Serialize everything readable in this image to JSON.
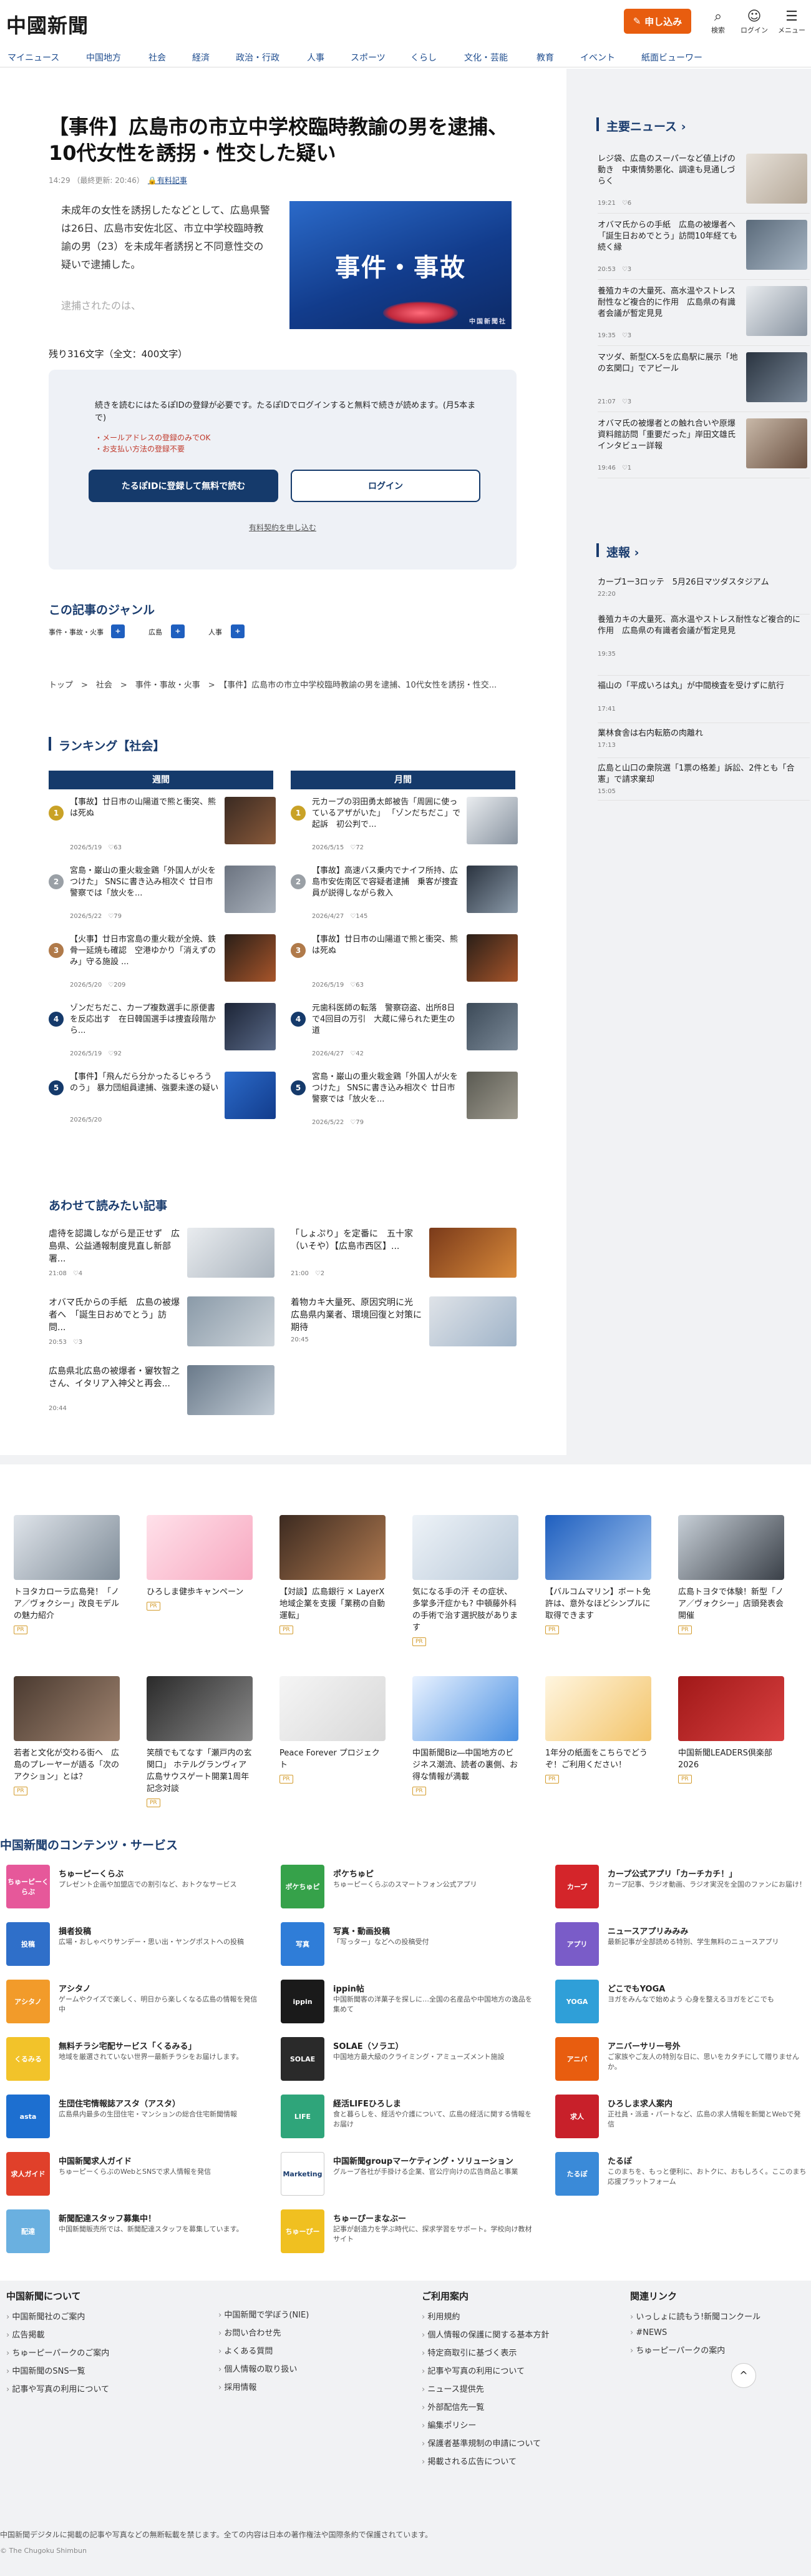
{
  "header": {
    "logo": "中國新聞",
    "apply": "申し込み",
    "icons": [
      {
        "icon": "search-icon",
        "label": "検索"
      },
      {
        "icon": "login-icon",
        "label": "ログイン"
      },
      {
        "icon": "menu-icon",
        "label": "メニュー"
      }
    ]
  },
  "nav": [
    "マイニュース",
    "中国地方",
    "社会",
    "経済",
    "政治・行政",
    "人事",
    "スポーツ",
    "くらし",
    "文化・芸能",
    "教育",
    "イベント",
    "紙面ビューワー"
  ],
  "article": {
    "title": "【事件】広島市の市立中学校臨時教諭の男を逮捕、10代女性を誘拐・性交した疑い",
    "time": "14:29",
    "updated": "（最終更新: 20:46）",
    "badge": "有料記事",
    "lead": "未成年の女性を誘拐したなどとして、広島県警は26日、広島市安佐北区、市立中学校臨時教諭の男（23）を未成年者誘拐と不同意性交の疑いで逮捕した。",
    "fade": "逮捕されたのは、",
    "image_text": "事件・事故",
    "image_caption": "中国新聞社",
    "remaining": "残り316文字（全文：400文字）"
  },
  "paywall": {
    "text": "続きを読むにはたるぽIDの登録が必要です。たるぽIDでログインすると無料で続きが読めます。(月5本まで)",
    "note1": "・メールアドレスの登録のみでOK",
    "note2": "・お支払い方法の登録不要",
    "register": "たるぽIDに登録して無料で読む",
    "login": "ログイン",
    "paid": "有料契約を申し込む"
  },
  "genre": {
    "title": "この記事のジャンル",
    "tags": [
      "事件・事故・火事",
      "広島",
      "人事"
    ]
  },
  "breadcrumb": "トップ　>　社会　>　事件・事故・火事　>　【事件】広島市の市立中学校臨時教諭の男を逮捕、10代女性を誘拐・性交...",
  "ranking": {
    "title": "ランキング【社会】",
    "weekly_label": "週間",
    "monthly_label": "月間",
    "weekly": [
      {
        "n": "1",
        "t": "【事故】廿日市の山陽道で熊と衝突、熊は死ぬ",
        "d": "2026/5/19　♡63"
      },
      {
        "n": "2",
        "t": "宮島・巌山の重火栽金鶏「外国人が火をつけた」 SNSに書き込み相次ぐ 廿日市警察では「放火を...",
        "d": "2026/5/22　♡79"
      },
      {
        "n": "3",
        "t": "【火事】廿日市宮島の重火栽が全焼、鉄骨一延焼も確認　空港ゆかり「消えずのみ」守る施設 ...",
        "d": "2026/5/20　♡209"
      },
      {
        "n": "4",
        "t": "ゾンだちだこ、カープ複数選手に原便書を反応出す　在日韓国選手は捜査段階から...",
        "d": "2026/5/19　♡92"
      },
      {
        "n": "5",
        "t": "【事件】「飛んだら分かったるじゃろうのう」 暴力団組員逮捕、強要未遂の疑い",
        "d": "2026/5/20"
      }
    ],
    "monthly": [
      {
        "n": "1",
        "t": "元カープの羽田勇太郎被告「周囲に使っているアザがいた」 「ゾンだちだこ」で起訴　初公判で...",
        "d": "2026/5/15　♡72"
      },
      {
        "n": "2",
        "t": "【事故】高速バス乗内でナイフ所持、広島市安佐南区で容疑者逮捕　乗客が捜査員が説得しながら救入",
        "d": "2026/4/27　♡145"
      },
      {
        "n": "3",
        "t": "【事故】廿日市の山陽道で熊と衝突、熊は死ぬ",
        "d": "2026/5/19　♡63"
      },
      {
        "n": "4",
        "t": "元歯科医師の転落　警察窃盗、出所8日で4回目の万引　大蔵に帰られた更生の道",
        "d": "2026/4/27　♡42"
      },
      {
        "n": "5",
        "t": "宮島・巌山の重火栽金鶏「外国人が火をつけた」 SNSに書き込み相次ぐ 廿日市警察では「放火を...",
        "d": "2026/5/22　♡79"
      }
    ]
  },
  "recommend": {
    "title": "あわせて読みたい記事",
    "items": [
      {
        "t": "虐待を認識しながら是正せず　広島県、公益通報制度見直し新部署...",
        "d": "21:08　♡4"
      },
      {
        "t": "「しょぷり」を定番に　五十家（いそや）【広島市西区】...",
        "d": "21:00　♡2"
      },
      {
        "t": "オバマ氏からの手紙　広島の被爆者へ　「誕生日おめでとう」訪問...",
        "d": "20:53　♡3"
      },
      {
        "t": "着物カキ大量死、原因究明に光　広島県内業者、環境回復と対策に期待",
        "d": "20:45"
      },
      {
        "t": "広島県北広島の被爆者・窶牧智之さん、イタリア入神父と再会...",
        "d": "20:44"
      }
    ]
  },
  "sidebar": {
    "main_title": "主要ニュース",
    "main_items": [
      {
        "t": "レジ袋、広島のスーパーなど値上げの動き　中東情勢悪化、調達も見通しづらく",
        "d": "19:21　♡6"
      },
      {
        "t": "オバマ氏からの手紙　広島の被爆者へ「誕生日おめでとう」訪問10年経ても続く縁",
        "d": "20:53　♡3"
      },
      {
        "t": "養殖カキの大量死、高水温やストレス耐性など複合的に作用　広島県の有識者会議が暫定見見",
        "d": "19:35　♡3"
      },
      {
        "t": "マツダ、新型CX-5を広島駅に展示「地の玄関口」でアピール",
        "d": "21:07　♡3"
      },
      {
        "t": "オバマ氏の被爆者との触れ合いや原爆資料館訪問「重要だった」岸田文雄氏インタビュー詳報",
        "d": "19:46　♡1"
      }
    ],
    "flash_title": "速報",
    "flash_items": [
      {
        "t": "カープ1ー3ロッテ　5月26日マツダスタジアム",
        "d": "22:20"
      },
      {
        "t": "養殖カキの大量死、高水温やストレス耐性など複合的に作用　広島県の有識者会議が暫定見見",
        "d": "19:35"
      },
      {
        "t": "福山の「平成いろは丸」が中間検査を受けずに航行",
        "d": "17:41"
      },
      {
        "t": "業林食舎は右内転筋の肉離れ",
        "d": "17:13"
      },
      {
        "t": "広島と山口の衆院選「1票の格差」訴訟、2件とも「合憲」で請求棄却",
        "d": "15:05"
      }
    ]
  },
  "promos": [
    {
      "t": "トヨタカローラ広島発！「ノア／ヴォクシー」改良モデルの魅力紹介"
    },
    {
      "t": "ひろしま健歩キャンペーン"
    },
    {
      "t": "【対談】広島銀行 × LayerX 地域企業を支援「業務の自動運転」"
    },
    {
      "t": "気になる手の汗 その症状、多掌多汗症かも? 中頓藤外科の手術で治す選択肢があります"
    },
    {
      "t": "【バルコムマリン】ボート免許は、意外なほどシンプルに取得できます"
    },
    {
      "t": "広島トヨタで体験！新型「ノア／ヴォクシー」店頭発表会開催"
    },
    {
      "t": "若者と文化が交わる街へ　広島のプレーヤーが語る「次のアクション」とは？"
    },
    {
      "t": "笑顔でもてなす「瀬戸内の玄関口」 ホテルグランヴィア広島サウスゲート開業1周年記念対談"
    },
    {
      "t": "Peace Forever プロジェクト"
    },
    {
      "t": "中国新聞Biz―中国地方のビジネス潮流、読者の裏側、お得な情報が満載"
    },
    {
      "t": "1年分の紙面をこちらでどうぞ！ご利用ください！"
    },
    {
      "t": "中国新聞LEADERS倶楽部2026"
    }
  ],
  "promo_pr": "PR",
  "services": {
    "title": "中国新聞のコンテンツ・サービス",
    "items": [
      {
        "icon": "ちゅーピーくらぶ",
        "name": "ちゅーピーくらぶ",
        "desc": "プレゼント企画や加盟店での割引など、おトクなサービス"
      },
      {
        "icon": "ポケちゅピ",
        "name": "ポケちゅピ",
        "desc": "ちゅーピーくらぶのスマートフォン公式アプリ"
      },
      {
        "icon": "カープ",
        "name": "カープ公式アプリ「カーチカチ！」",
        "desc": "カープ記事、ラジオ動画、ラジオ実況を全国のファンにお届け！"
      },
      {
        "icon": "投稿",
        "name": "損者投稿",
        "desc": "広場・おしゃべりサンデー・思い出・ヤングポストへの投稿"
      },
      {
        "icon": "写真",
        "name": "写真・動画投稿",
        "desc": "「写っター」などへの投稿受付"
      },
      {
        "icon": "アプリ",
        "name": "ニュースアプリみみみ",
        "desc": "最新記事が全部読める特別、学生無料のニュースアプリ"
      },
      {
        "icon": "アシタノ",
        "name": "アシタノ",
        "desc": "ゲームやクイズで楽しく、明日から楽しくなる広島の情報を発信中"
      },
      {
        "icon": "ippin",
        "name": "ippin帖",
        "desc": "中国新聞客の洋菓子を探しに…全国の名産品や中国地方の逸品を集めて"
      },
      {
        "icon": "YOGA",
        "name": "どこでもYOGA",
        "desc": "ヨガをみんなで始めよう 心身を整えるヨガをどこでも"
      },
      {
        "icon": "くるみる",
        "name": "無料チラシ宅配サービス「くるみる」",
        "desc": "地域を厳選されていない世界一最新チラシをお届けします。"
      },
      {
        "icon": "SOLAE",
        "name": "SOLAE（ソラエ）",
        "desc": "中国地方最大級のクライミング・アミューズメント施設"
      },
      {
        "icon": "アニバ",
        "name": "アニバーサリー号外",
        "desc": "ご家族やご友人の特別な日に、思いをカタチにして贈りませんか。"
      },
      {
        "icon": "asta",
        "name": "生団住宅情報誌アスタ（アスタ）",
        "desc": "広島県内最多の生団住宅・マンションの総合住宅新聞情報"
      },
      {
        "icon": "LIFE",
        "name": "経活LIFEひろしま",
        "desc": "食と暮らしを、経活や介護について、広島の経活に関する情報をお届け"
      },
      {
        "icon": "求人",
        "name": "ひろしま求人案内",
        "desc": "正社員・派遣・パートなど、広島の求人情報を新聞とWebで発信"
      },
      {
        "icon": "求人ガイド",
        "name": "中国新聞求人ガイド",
        "desc": "ちゅーピーくらぶのWebとSNSで求人情報を発信"
      },
      {
        "icon": "Marketing",
        "name": "中国新聞groupマーケティング・ソリューション",
        "desc": "グループ各社が手掛ける企業、官公庁向けの広告商品と事業"
      },
      {
        "icon": "たるぽ",
        "name": "たるぽ",
        "desc": "このまちを、もっと便利に、おトクに、おもしろく。ここのまち応援プラットフォーム"
      },
      {
        "icon": "配達",
        "name": "新聞配達スタッフ募集中！",
        "desc": "中国新聞販売所では、新聞配達スタッフを募集しています。"
      },
      {
        "icon": "ちゅーぴー",
        "name": "ちゅーぴーまなぶー",
        "desc": "記事が創造力を学ぶ時代に、探求学習をサポート。学校向け教材サイト"
      }
    ]
  },
  "footer": {
    "col1_title": "中国新聞について",
    "col1": [
      "中国新聞社のご案内",
      "広告掲載",
      "ちゅーピーパークのご案内",
      "中国新聞のSNS一覧",
      "記事や写真の利用について"
    ],
    "col2": [
      "中国新聞で学ぼう(NIE)",
      "お問い合わせ先",
      "よくある質問",
      "個人情報の取り扱い",
      "採用情報"
    ],
    "col3_title": "ご利用案内",
    "col3": [
      "利用規約",
      "個人情報の保護に関する基本方針",
      "特定商取引に基づく表示",
      "記事や写真の利用について",
      "ニュース提供先",
      "外部配信先一覧",
      "編集ポリシー",
      "保護者基準規制の申請について",
      "掲載される広告について"
    ],
    "col4_title": "関連リンク",
    "col4": [
      "いっしょに読もう!新聞コンクール",
      "#NEWS",
      "ちゅーピーパークの案内"
    ],
    "copyright": "中国新聞デジタルに掲載の記事や写真などの無断転載を禁じます。全ての内容は日本の著作権法や国際条約で保護されています。",
    "copyright2": "© The Chugoku Shimbun",
    "totop": "^"
  },
  "colors": {
    "accent": "#e85d0f",
    "navy": "#153a6b",
    "link": "#1f4d8f"
  }
}
